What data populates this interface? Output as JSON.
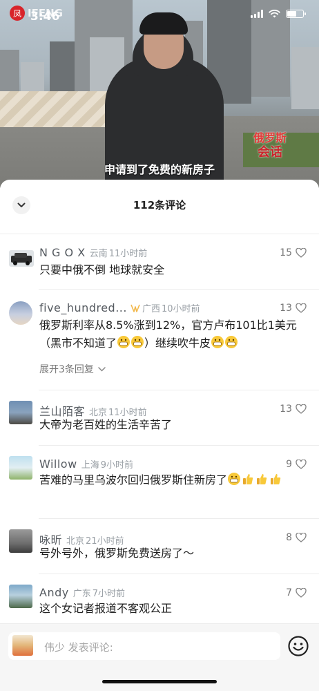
{
  "status_bar": {
    "time": "3:46",
    "logo_text": "IFENG",
    "logo_glyph": "凤"
  },
  "video": {
    "subtitle": "申请到了免费的新房子",
    "channel_badge_line1": "俄罗斯",
    "channel_badge_line2": "会话"
  },
  "comments_header": {
    "title": "112条评论"
  },
  "comments": [
    {
      "name": "N G O X",
      "location": "云南",
      "time": "11小时前",
      "likes": "15",
      "text": "只要中俄不倒 地球就安全"
    },
    {
      "name": "five_hundred...",
      "location": "广西",
      "time": "10小时前",
      "likes": "13",
      "text": "俄罗斯利率从8.5%涨到12%，官方卢布101比1美元（黑市不知道了",
      "text_tail": "）继续吹牛皮",
      "expand_label": "展开3条回复"
    },
    {
      "name": "兰山陌客",
      "location": "北京",
      "time": "11小时前",
      "likes": "13",
      "text": "大帝为老百姓的生活辛苦了"
    },
    {
      "name": "Willow",
      "location": "上海",
      "time": "9小时前",
      "likes": "9",
      "text": "苦难的马里乌波尔回归俄罗斯住新房了"
    },
    {
      "name": "咏昕",
      "location": "北京",
      "time": "21小时前",
      "likes": "8",
      "text": "号外号外，俄罗斯免费送房了～"
    },
    {
      "name": "Andy",
      "location": "广东",
      "time": "7小时前",
      "likes": "7",
      "text": "这个女记者报道不客观公正"
    }
  ],
  "input": {
    "placeholder": "伟少 发表评论:"
  },
  "colors": {
    "accent_badge": "#f2b84b",
    "text_muted": "#9aa0a6"
  }
}
